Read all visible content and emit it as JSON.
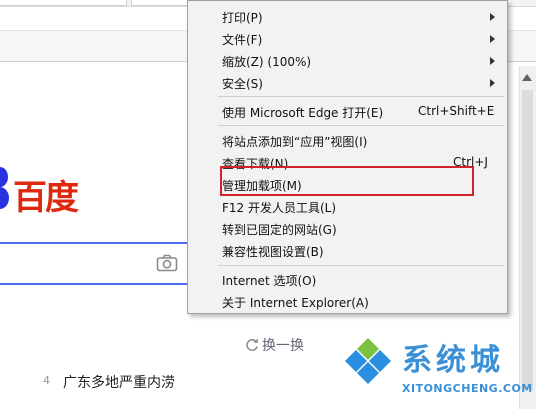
{
  "menu": {
    "items": [
      {
        "label": "打印(P)",
        "shortcut": "",
        "submenu": true
      },
      {
        "label": "文件(F)",
        "shortcut": "",
        "submenu": true
      },
      {
        "label": "缩放(Z) (100%)",
        "shortcut": "",
        "submenu": true
      },
      {
        "label": "安全(S)",
        "shortcut": "",
        "submenu": true
      },
      {
        "label": "使用 Microsoft Edge 打开(E)",
        "shortcut": "Ctrl+Shift+E",
        "submenu": false
      },
      {
        "label": "将站点添加到“应用”视图(I)",
        "shortcut": "",
        "submenu": false
      },
      {
        "label": "查看下载(N)",
        "shortcut": "Ctrl+J",
        "submenu": false
      },
      {
        "label": "管理加载项(M)",
        "shortcut": "",
        "submenu": false
      },
      {
        "label": "F12 开发人员工具(L)",
        "shortcut": "",
        "submenu": false
      },
      {
        "label": "转到已固定的网站(G)",
        "shortcut": "",
        "submenu": false
      },
      {
        "label": "兼容性视图设置(B)",
        "shortcut": "",
        "submenu": false
      },
      {
        "label": "Internet 选项(O)",
        "shortcut": "",
        "submenu": false
      },
      {
        "label": "关于 Internet Explorer(A)",
        "shortcut": "",
        "submenu": false
      }
    ]
  },
  "page": {
    "logo_text": "百度",
    "refresh_label": "换一换",
    "hot_item_number": "4",
    "hot_item_text": "广东多地严重内涝"
  },
  "watermark": {
    "title": "系统城",
    "url": "XITONGCHENG.COM"
  },
  "colors": {
    "highlight_box": "#d3212b",
    "baidu_red": "#de2910",
    "baidu_blue": "#2932e1",
    "search_border": "#4e6ef2",
    "watermark_blue": "#3a8fd6"
  }
}
